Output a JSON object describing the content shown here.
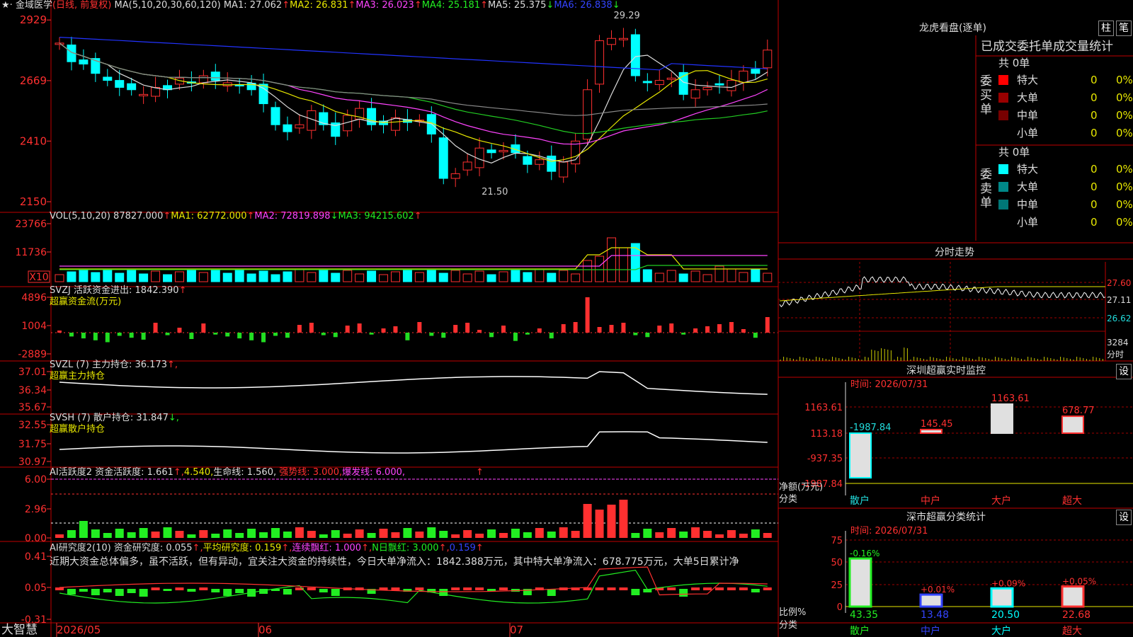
{
  "stock_name": "金域医学",
  "period_label": "(日线, 前复权)",
  "brand": "大智慧",
  "ma_header": {
    "label": "MA(5,10,20,30,60,120)",
    "ma1": "MA1: 27.062",
    "ma1_a": "↑",
    "ma2": "MA2: 26.831",
    "ma2_a": "↑",
    "ma3": "MA3: 26.023",
    "ma3_a": "↑",
    "ma4": "MA4: 25.181",
    "ma4_a": "↑",
    "ma5": "MA5: 25.375",
    "ma5_a": "↓",
    "ma6": "MA6: 26.838",
    "ma6_a": "↓"
  },
  "price_axis": [
    "2929",
    "2669",
    "2410",
    "2150"
  ],
  "price_hi_label": "29.29",
  "price_lo_label": "21.50",
  "vol_header": {
    "label": "VOL(5,10,20)",
    "value": "87827.000",
    "v_a": "↑",
    "ma1": "MA1: 62772.000",
    "ma1_a": "↑",
    "ma2": "MA2: 72819.898",
    "ma2_a": "↓",
    "ma3": "MA3: 94215.602",
    "ma3_a": "↑"
  },
  "vol_axis": [
    "23766",
    "11736",
    "X10"
  ],
  "svzj": {
    "label": "SVZJ  活跃资金进出: 1842.390",
    "a": "↑",
    "sub": "超赢资金流(万元)",
    "axis": [
      "4896",
      "1004",
      "-2889"
    ]
  },
  "svzl": {
    "label": "SVZL (7) 主力持仓: 36.173",
    "a": "↑,",
    "sub": "超赢主力持仓",
    "axis": [
      "37.01",
      "36.34",
      "35.67"
    ]
  },
  "svsh": {
    "label": "SVSH (7) 散户持仓: 31.847",
    "a": "↓,",
    "sub": "超赢散户持仓",
    "axis": [
      "32.55",
      "31.75",
      "30.97"
    ]
  },
  "ai_active": {
    "label": "AI活跃度2 资金活跃度: 1.661",
    "a1": "↑,",
    "v2": "4.540,",
    "life": "生命线: 1.560,",
    "strong": "强势线: 3.000,",
    "burst": "爆发线: 6.000,",
    "a3": "↑",
    "axis": [
      "6.00",
      "2.96",
      "0.00"
    ]
  },
  "ai_research": {
    "label": "AI研究度2(10) 资金研究度: 0.055",
    "a1": "↑,",
    "avg": "平均研究度: 0.159",
    "a2": "↑,",
    "cont": "连续飘红: 1.000",
    "a3": "↑,",
    "nday": "N日飘红: 3.000",
    "a4": "↑,",
    "last": "0.159",
    "a5": "↑",
    "axis": [
      "0.41",
      "0.05",
      "-0.31"
    ],
    "commentary": "近期大资金总体偏多，虽不活跃，但有异动，宜关注大资金的持续性，今日大单净流入：1842.388万元，其中特大单净流入：678.775万元，大单5日累计净"
  },
  "time_axis": [
    "2026/05",
    "06",
    "07"
  ],
  "dragon": {
    "title": "龙虎看盘(逐单)",
    "btn1": "柱",
    "btn2": "笔",
    "heading": "已成交委托单成交量统计",
    "buy": {
      "label": "委买单",
      "total": "共 0单",
      "rows": [
        {
          "name": "特大",
          "val": "0",
          "pct": "0%",
          "color": "#ff0000"
        },
        {
          "name": "大单",
          "val": "0",
          "pct": "0%",
          "color": "#990000"
        },
        {
          "name": "中单",
          "val": "0",
          "pct": "0%",
          "color": "#770000"
        },
        {
          "name": "小单",
          "val": "0",
          "pct": "0%",
          "color": "#000000"
        }
      ]
    },
    "sell": {
      "label": "委卖单",
      "total": "共 0单",
      "rows": [
        {
          "name": "特大",
          "val": "0",
          "pct": "0%",
          "color": "#00ffff"
        },
        {
          "name": "大单",
          "val": "0",
          "pct": "0%",
          "color": "#008888"
        },
        {
          "name": "中单",
          "val": "0",
          "pct": "0%",
          "color": "#007777"
        },
        {
          "name": "小单",
          "val": "0",
          "pct": "0%",
          "color": "#000000"
        }
      ]
    }
  },
  "intraday": {
    "title": "分时走势",
    "axis": [
      "27.60",
      "27.11",
      "26.62",
      "3284"
    ],
    "unit": "分时"
  },
  "monitor": {
    "title": "深圳超赢实时监控",
    "btn": "设",
    "time": "时间: 2026/07/31",
    "axis": [
      "1163.61",
      "113.18",
      "-937.35",
      "-1987.84"
    ],
    "ylabel": "净额(万元)",
    "xlabel": "分类"
  },
  "classify": {
    "title": "深市超赢分类统计",
    "btn": "设",
    "time": "时间: 2026/07/31",
    "axis": [
      "75",
      "50",
      "25",
      "0"
    ],
    "ylabel": "比例%",
    "xlabel": "分类"
  },
  "colors": {
    "up": "#ff3030",
    "down": "#00ffff",
    "frame": "#c00000",
    "ma1": "#dddddd",
    "ma2": "#e8e800",
    "ma3": "#ff44ff",
    "ma4": "#22cc22",
    "ma5": "#888888",
    "ma6": "#2233ff"
  },
  "chart_data": [
    {
      "type": "candlestick",
      "title": "金域医学 (日线, 前复权)",
      "x_range": [
        "2026/05",
        "2026/07/31"
      ],
      "ylim": [
        21.5,
        29.29
      ],
      "high": 29.29,
      "low": 21.5,
      "ma": {
        "MA1": 27.062,
        "MA2": 26.831,
        "MA3": 26.023,
        "MA4": 25.181,
        "MA5": 25.375,
        "MA6": 26.838
      },
      "close": [
        28.3,
        27.5,
        27.4,
        27.0,
        26.7,
        26.4,
        26.3,
        26.1,
        26.4,
        26.3,
        26.8,
        26.6,
        26.9,
        26.7,
        26.6,
        26.5,
        26.3,
        25.7,
        24.8,
        24.5,
        24.8,
        25.4,
        24.8,
        24.3,
        25.2,
        25.5,
        24.8,
        24.8,
        25.1,
        24.9,
        25.0,
        24.4,
        22.5,
        22.7,
        23.2,
        23.8,
        23.6,
        23.7,
        23.6,
        23.1,
        23.3,
        22.8,
        23.2,
        24.1,
        26.3,
        28.4,
        28.5,
        28.5,
        26.9,
        26.6,
        26.7,
        26.8,
        26.1,
        26.3,
        26.4,
        26.5,
        26.7,
        27.1,
        27.0,
        28.0
      ]
    },
    {
      "type": "bar",
      "title": "VOL(5,10,20)",
      "series": [
        {
          "name": "VOL",
          "last": 87827.0
        },
        {
          "name": "MA1",
          "last": 62772.0
        },
        {
          "name": "MA2",
          "last": 72819.898
        },
        {
          "name": "MA3",
          "last": 94215.602
        }
      ],
      "ylim": [
        0,
        23766
      ],
      "unit": "X10"
    },
    {
      "type": "bar",
      "title": "SVZJ 活跃资金进出",
      "subtitle": "超赢资金流(万元)",
      "ylim": [
        -2889,
        4896
      ],
      "last": 1842.39
    },
    {
      "type": "line",
      "title": "SVZL (7) 主力持仓",
      "subtitle": "超赢主力持仓",
      "ylim": [
        35.67,
        37.01
      ],
      "last": 36.173
    },
    {
      "type": "line",
      "title": "SVSH (7) 散户持仓",
      "subtitle": "超赢散户持仓",
      "ylim": [
        30.97,
        32.55
      ],
      "last": 31.847
    },
    {
      "type": "bar",
      "title": "AI活跃度2",
      "ylim": [
        0,
        6
      ],
      "values": {
        "资金活跃度": 1.661,
        "v2": 4.54,
        "生命线": 1.56,
        "强势线": 3.0,
        "爆发线": 6.0
      }
    },
    {
      "type": "line",
      "title": "AI研究度2(10)",
      "ylim": [
        -0.31,
        0.41
      ],
      "values": {
        "资金研究度": 0.055,
        "平均研究度": 0.159,
        "连续飘红": 1.0,
        "N日飘红": 3.0
      }
    },
    {
      "type": "table",
      "title": "已成交委托单成交量统计",
      "rows": [
        [
          "委买单",
          "特大",
          0,
          "0%"
        ],
        [
          "委买单",
          "大单",
          0,
          "0%"
        ],
        [
          "委买单",
          "中单",
          0,
          "0%"
        ],
        [
          "委买单",
          "小单",
          0,
          "0%"
        ],
        [
          "委卖单",
          "特大",
          0,
          "0%"
        ],
        [
          "委卖单",
          "大单",
          0,
          "0%"
        ],
        [
          "委卖单",
          "中单",
          0,
          "0%"
        ],
        [
          "委卖单",
          "小单",
          0,
          "0%"
        ]
      ]
    },
    {
      "type": "line",
      "title": "分时走势",
      "ylim": [
        26.62,
        27.6
      ],
      "volume_max": 3284
    },
    {
      "type": "bar",
      "title": "深圳超赢实时监控",
      "categories": [
        "散户",
        "中户",
        "大户",
        "超大"
      ],
      "values": [
        -1987.84,
        145.45,
        1163.61,
        678.77
      ],
      "ylim": [
        -1987.84,
        1163.61
      ],
      "ylabel": "净额(万元)",
      "xlabel": "分类"
    },
    {
      "type": "bar",
      "title": "深市超赢分类统计",
      "categories": [
        "散户",
        "中户",
        "大户",
        "超大"
      ],
      "values": [
        43.35,
        13.48,
        20.5,
        22.68
      ],
      "changes": [
        "-0.16%",
        "+0.01%",
        "+0.09%",
        "+0.05%"
      ],
      "ylim": [
        0,
        75
      ],
      "ylabel": "比例%",
      "xlabel": "分类"
    }
  ]
}
